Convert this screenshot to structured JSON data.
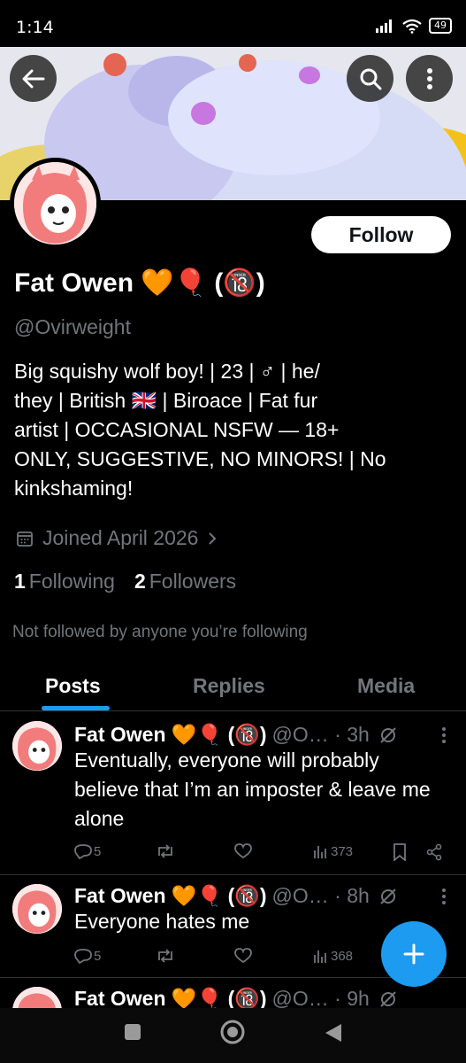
{
  "status_bar": {
    "time": "1:14",
    "battery": "49"
  },
  "header": {
    "back_icon": "arrow-left-icon",
    "search_icon": "search-icon",
    "more_icon": "more-vertical-icon"
  },
  "profile": {
    "display_name": "Fat Owen 🧡🎈 (🔞)",
    "handle": "@Ovirweight",
    "follow_label": "Follow",
    "bio_lines": [
      "Big squishy wolf boy! | 23 | ♂ | he/",
      "they | British 🇬🇧 | Biroace | Fat fur",
      "artist | OCCASIONAL NSFW — 18+",
      "ONLY, SUGGESTIVE, NO MINORS! | No",
      "kinkshaming!"
    ],
    "joined": "Joined April 2026",
    "following_count": "1",
    "following_label": "Following",
    "followers_count": "2",
    "followers_label": "Followers",
    "not_followed_text": "Not followed by anyone you’re following"
  },
  "tabs": [
    {
      "label": "Posts",
      "active": true
    },
    {
      "label": "Replies",
      "active": false
    },
    {
      "label": "Media",
      "active": false
    }
  ],
  "tweets": [
    {
      "name": "Fat Owen 🧡🎈 (🔞)",
      "meta": "@O… · 3h",
      "text": "Eventually, everyone will probably believe that I’m an imposter & leave me alone",
      "replies": "5",
      "views": "373"
    },
    {
      "name": "Fat Owen 🧡🎈 (🔞)",
      "meta": "@O… · 8h",
      "text": "Everyone hates me",
      "replies": "5",
      "views": "368"
    },
    {
      "name": "Fat Owen 🧡🎈 (🔞)",
      "meta": "@O… · 9h",
      "text": "",
      "replies": "",
      "views": ""
    }
  ],
  "fab_icon": "plus-icon",
  "colors": {
    "background": "#000000",
    "accent": "#1d9bf0",
    "secondary_text": "#71767b",
    "divider": "#2f3336"
  }
}
